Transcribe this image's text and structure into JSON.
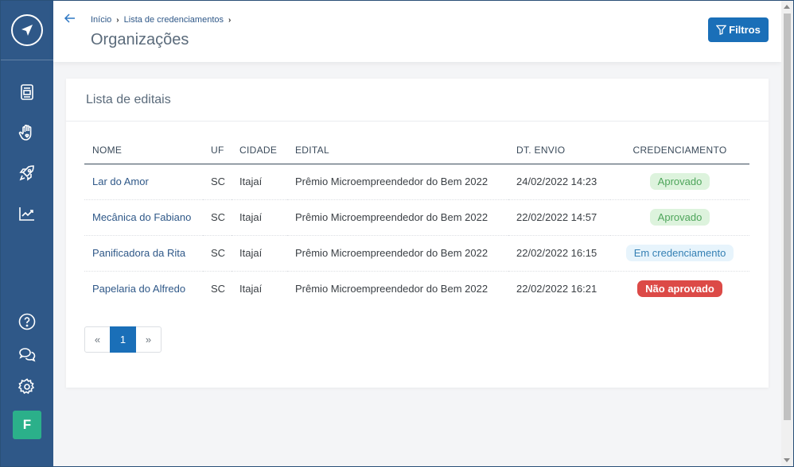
{
  "breadcrumb": {
    "home": "Início",
    "list": "Lista de credenciamentos"
  },
  "header": {
    "title": "Organizações",
    "filter_label": "Filtros"
  },
  "card": {
    "title": "Lista de editais"
  },
  "table": {
    "columns": {
      "nome": "NOME",
      "uf": "UF",
      "cidade": "CIDADE",
      "edital": "EDITAL",
      "dt_envio": "DT. ENVIO",
      "credenciamento": "CREDENCIAMENTO"
    },
    "rows": [
      {
        "nome": "Lar do Amor",
        "uf": "SC",
        "cidade": "Itajaí",
        "edital": "Prêmio Microempreendedor do Bem 2022",
        "dt_envio": "24/02/2022 14:23",
        "status": "Aprovado"
      },
      {
        "nome": "Mecânica do Fabiano",
        "uf": "SC",
        "cidade": "Itajaí",
        "edital": "Prêmio Microempreendedor do Bem 2022",
        "dt_envio": "22/02/2022 14:57",
        "status": "Aprovado"
      },
      {
        "nome": "Panificadora da Rita",
        "uf": "SC",
        "cidade": "Itajaí",
        "edital": "Prêmio Microempreendedor do Bem 2022",
        "dt_envio": "22/02/2022 16:15",
        "status": "Em credenciamento"
      },
      {
        "nome": "Papelaria do Alfredo",
        "uf": "SC",
        "cidade": "Itajaí",
        "edital": "Prêmio Microempreendedor do Bem 2022",
        "dt_envio": "22/02/2022 16:21",
        "status": "Não aprovado"
      }
    ]
  },
  "pagination": {
    "prev": "«",
    "current": "1",
    "next": "»"
  },
  "user": {
    "initial": "F"
  },
  "colors": {
    "sidebar": "#2f5888",
    "primary": "#1a6fb8",
    "approved": "#4ea55b",
    "rejected": "#dc4a47",
    "avatar": "#2bb08a"
  },
  "icons": [
    "compass-logo-icon",
    "document-icon",
    "hand-heart-icon",
    "rocket-icon",
    "chart-icon",
    "help-icon",
    "chat-icon",
    "gear-icon",
    "back-arrow-icon",
    "filter-icon"
  ]
}
